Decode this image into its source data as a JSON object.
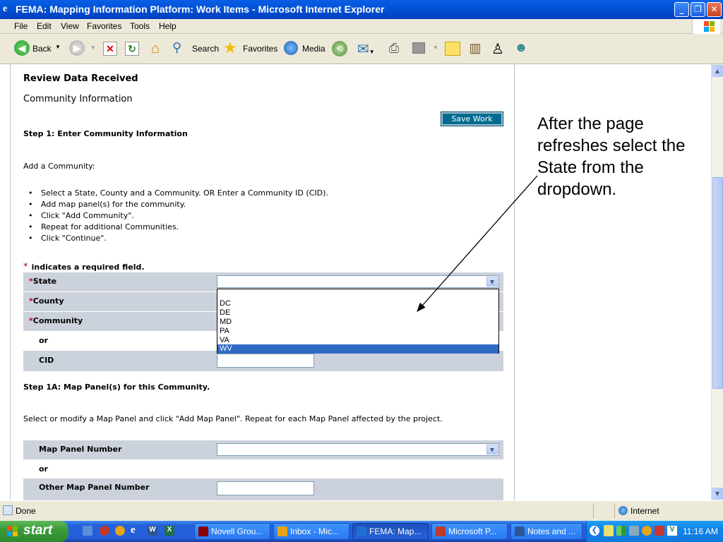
{
  "window": {
    "title": "FEMA: Mapping Information Platform: Work Items - Microsoft Internet Explorer"
  },
  "menu": [
    "File",
    "Edit",
    "View",
    "Favorites",
    "Tools",
    "Help"
  ],
  "toolbar": {
    "back": "Back",
    "search": "Search",
    "favorites": "Favorites",
    "media": "Media"
  },
  "page": {
    "section_title": "Review Data Received",
    "subtitle": "Community Information",
    "save_button": "Save Work",
    "step1_title": "Step 1: Enter Community Information",
    "add_community": "Add a Community:",
    "instructions": [
      "Select a State, County and a Community. OR Enter a Community ID (CID).",
      "Add map panel(s) for the community.",
      "Click \"Add Community\".",
      "Repeat for additional Communities.",
      "Click \"Continue\"."
    ],
    "required_star": "*",
    "required_note": "indicates a required field.",
    "fields": {
      "state": "State",
      "county": "County",
      "community": "Community",
      "or": "or",
      "cid": "CID"
    },
    "state_options": [
      "",
      "DC",
      "DE",
      "MD",
      "PA",
      "VA",
      "WV"
    ],
    "state_highlighted": "WV",
    "step1a_title": "Step 1A: Map Panel(s) for this Community.",
    "step1a_text": "Select or modify a Map Panel and click \"Add Map Panel\". Repeat for each Map Panel affected by the project.",
    "map_panel_number": "Map Panel Number",
    "or2": "or",
    "other_map_panel": "Other Map Panel Number"
  },
  "callout": "After the page refreshes select the State from the dropdown.",
  "status": {
    "left": "Done",
    "zone": "Internet"
  },
  "taskbar": {
    "start": "start",
    "tasks": [
      {
        "label": "Novell Grou...",
        "color": "#8b0000"
      },
      {
        "label": "Inbox - Mic...",
        "color": "#e8a317"
      },
      {
        "label": "FEMA: Map...",
        "color": "#1f6fd1",
        "active": true
      },
      {
        "label": "Microsoft P...",
        "color": "#c0392b"
      },
      {
        "label": "Notes and ...",
        "color": "#2b5797"
      }
    ],
    "clock": "11:16 AM"
  }
}
